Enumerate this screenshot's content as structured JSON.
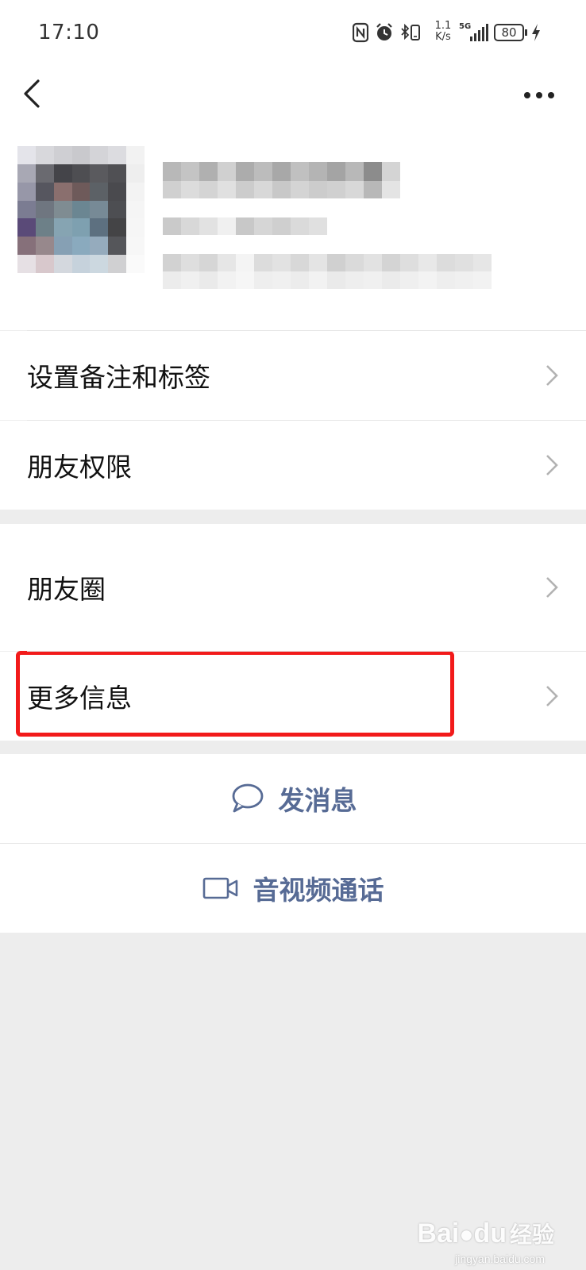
{
  "status_bar": {
    "time": "17:10",
    "net_speed_value": "1.1",
    "net_speed_unit": "K/s",
    "signal_label": "5G",
    "battery": "80",
    "icons": [
      "nfc-icon",
      "alarm-icon",
      "bluetooth-vibrate-icon",
      "network-speed",
      "signal-5g-icon",
      "battery-icon",
      "charging-icon"
    ]
  },
  "nav": {
    "back_icon": "chevron-left-icon",
    "more_icon": "more-dots-icon"
  },
  "profile": {
    "avatar": "pixelated-avatar",
    "name_obscured": true
  },
  "menu": {
    "section1": [
      {
        "label": "设置备注和标签"
      },
      {
        "label": "朋友权限"
      }
    ],
    "section2": [
      {
        "label": "朋友圈"
      },
      {
        "label": "更多信息"
      }
    ]
  },
  "actions": {
    "send_message": {
      "label": "发消息",
      "icon": "chat-bubble-icon"
    },
    "video_call": {
      "label": "音视频通话",
      "icon": "video-camera-icon"
    }
  },
  "colors": {
    "accent_link": "#576b95",
    "highlight": "#f21a1a",
    "background": "#ededed"
  },
  "watermark": {
    "brand": "Bai",
    "brand2": "du",
    "brand3": "经验",
    "url": "jingyan.baidu.com"
  }
}
